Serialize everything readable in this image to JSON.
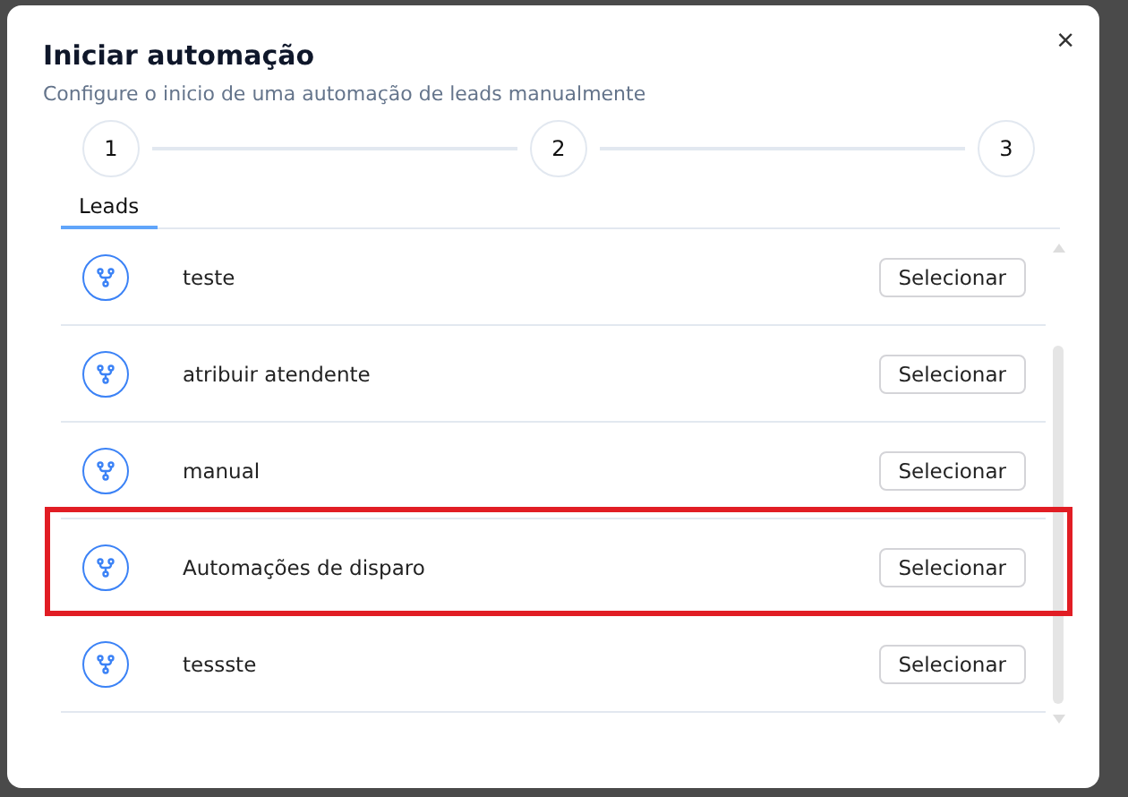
{
  "dialog": {
    "title": "Iniciar automação",
    "subtitle": "Configure o inicio de uma automação de leads manualmente",
    "close": "×"
  },
  "steps": [
    {
      "label": "1"
    },
    {
      "label": "2"
    },
    {
      "label": "3"
    }
  ],
  "tabs": [
    {
      "label": "Leads",
      "selected": true
    }
  ],
  "automations": [
    {
      "name": "teste",
      "button": "Selecionar",
      "highlighted": false
    },
    {
      "name": "atribuir atendente",
      "button": "Selecionar",
      "highlighted": false
    },
    {
      "name": "manual",
      "button": "Selecionar",
      "highlighted": false
    },
    {
      "name": "Automações de disparo",
      "button": "Selecionar",
      "highlighted": true
    },
    {
      "name": "tessste",
      "button": "Selecionar",
      "highlighted": false
    }
  ]
}
